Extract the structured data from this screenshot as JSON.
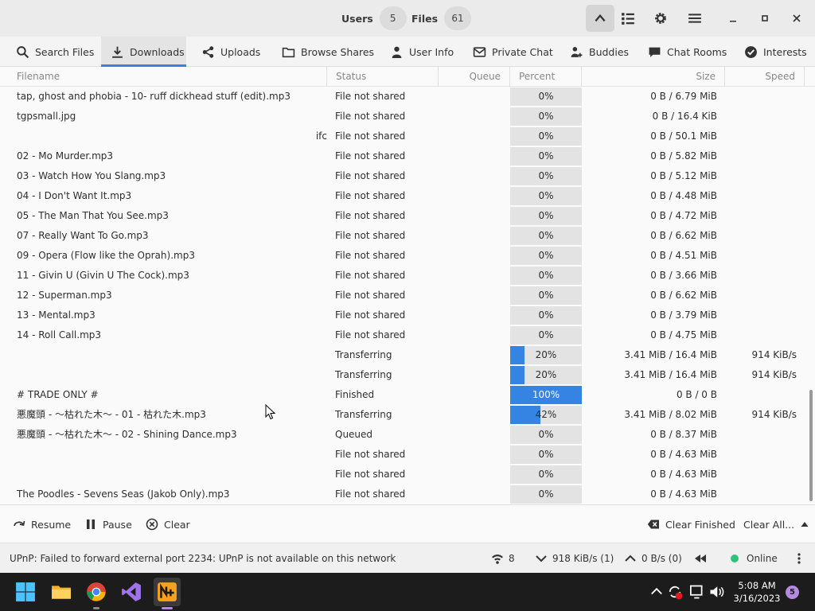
{
  "header": {
    "users_label": "Users",
    "users_count": "5",
    "files_label": "Files",
    "files_count": "61"
  },
  "tabs": [
    {
      "label": "Search Files",
      "icon": "search-icon"
    },
    {
      "label": "Downloads",
      "icon": "download-icon",
      "active": true
    },
    {
      "label": "Uploads",
      "icon": "share-icon"
    },
    {
      "label": "Browse Shares",
      "icon": "folder-icon"
    },
    {
      "label": "User Info",
      "icon": "user-icon"
    },
    {
      "label": "Private Chat",
      "icon": "mail-icon"
    },
    {
      "label": "Buddies",
      "icon": "buddies-icon"
    },
    {
      "label": "Chat Rooms",
      "icon": "chat-bubble-icon"
    },
    {
      "label": "Interests",
      "icon": "check-circle-icon"
    }
  ],
  "columns": [
    "Filename",
    "Status",
    "Queue",
    "Percent",
    "Size",
    "Speed"
  ],
  "rows": [
    {
      "filename": "tap, ghost and phobia - 10- ruff dickhead stuff (edit).mp3",
      "status": "File not shared",
      "queue": "",
      "percent": 0,
      "percent_label": "0%",
      "size": "0 B / 6.79 MiB",
      "speed": ""
    },
    {
      "filename": "tgpsmall.jpg",
      "status": "File not shared",
      "queue": "",
      "percent": 0,
      "percent_label": "0%",
      "size": "0 B / 16.4 KiB",
      "speed": ""
    },
    {
      "filename": "ifc",
      "status": "File not shared",
      "queue": "",
      "percent": 0,
      "percent_label": "0%",
      "size": "0 B / 50.1 MiB",
      "speed": ""
    },
    {
      "filename": "02 - Mo Murder.mp3",
      "status": "File not shared",
      "queue": "",
      "percent": 0,
      "percent_label": "0%",
      "size": "0 B / 5.82 MiB",
      "speed": ""
    },
    {
      "filename": "03 - Watch How You Slang.mp3",
      "status": "File not shared",
      "queue": "",
      "percent": 0,
      "percent_label": "0%",
      "size": "0 B / 5.12 MiB",
      "speed": ""
    },
    {
      "filename": "04 - I Don't Want It.mp3",
      "status": "File not shared",
      "queue": "",
      "percent": 0,
      "percent_label": "0%",
      "size": "0 B / 4.48 MiB",
      "speed": ""
    },
    {
      "filename": "05 - The Man That You See.mp3",
      "status": "File not shared",
      "queue": "",
      "percent": 0,
      "percent_label": "0%",
      "size": "0 B / 4.72 MiB",
      "speed": ""
    },
    {
      "filename": "07 - Really Want To Go.mp3",
      "status": "File not shared",
      "queue": "",
      "percent": 0,
      "percent_label": "0%",
      "size": "0 B / 6.62 MiB",
      "speed": ""
    },
    {
      "filename": "09 - Opera (Flow like the Oprah).mp3",
      "status": "File not shared",
      "queue": "",
      "percent": 0,
      "percent_label": "0%",
      "size": "0 B / 4.51 MiB",
      "speed": ""
    },
    {
      "filename": "11 - Givin U (Givin U The Cock).mp3",
      "status": "File not shared",
      "queue": "",
      "percent": 0,
      "percent_label": "0%",
      "size": "0 B / 3.66 MiB",
      "speed": ""
    },
    {
      "filename": "12 - Superman.mp3",
      "status": "File not shared",
      "queue": "",
      "percent": 0,
      "percent_label": "0%",
      "size": "0 B / 6.62 MiB",
      "speed": ""
    },
    {
      "filename": "13 - Mental.mp3",
      "status": "File not shared",
      "queue": "",
      "percent": 0,
      "percent_label": "0%",
      "size": "0 B / 3.79 MiB",
      "speed": ""
    },
    {
      "filename": "14 - Roll Call.mp3",
      "status": "File not shared",
      "queue": "",
      "percent": 0,
      "percent_label": "0%",
      "size": "0 B / 4.75 MiB",
      "speed": ""
    },
    {
      "filename": "",
      "status": "Transferring",
      "queue": "",
      "percent": 20,
      "percent_label": "20%",
      "size": "3.41 MiB / 16.4 MiB",
      "speed": "914 KiB/s"
    },
    {
      "filename": "",
      "status": "Transferring",
      "queue": "",
      "percent": 20,
      "percent_label": "20%",
      "size": "3.41 MiB / 16.4 MiB",
      "speed": "914 KiB/s"
    },
    {
      "filename": "# TRADE ONLY #",
      "status": "Finished",
      "queue": "",
      "percent": 100,
      "percent_label": "100%",
      "size": "0 B / 0 B",
      "speed": ""
    },
    {
      "filename": "悪魔頭 - ～枯れた木～ - 01 - 枯れた木.mp3",
      "status": "Transferring",
      "queue": "",
      "percent": 42,
      "percent_label": "42%",
      "size": "3.41 MiB / 8.02 MiB",
      "speed": "914 KiB/s"
    },
    {
      "filename": "悪魔頭 - ～枯れた木～ - 02 - Shining Dance.mp3",
      "status": "Queued",
      "queue": "",
      "percent": 0,
      "percent_label": "0%",
      "size": "0 B / 8.37 MiB",
      "speed": ""
    },
    {
      "filename": "",
      "status": "File not shared",
      "queue": "",
      "percent": 0,
      "percent_label": "0%",
      "size": "0 B / 4.63 MiB",
      "speed": ""
    },
    {
      "filename": "",
      "status": "File not shared",
      "queue": "",
      "percent": 0,
      "percent_label": "0%",
      "size": "0 B / 4.63 MiB",
      "speed": ""
    },
    {
      "filename": "The Poodles - Sevens Seas (Jakob Only).mp3",
      "status": "File not shared",
      "queue": "",
      "percent": 0,
      "percent_label": "0%",
      "size": "0 B / 4.63 MiB",
      "speed": ""
    }
  ],
  "actions": {
    "resume": "Resume",
    "pause": "Pause",
    "clear": "Clear",
    "clear_finished": "Clear Finished",
    "clear_all": "Clear All..."
  },
  "statusbar": {
    "message": "UPnP: Failed to forward external port 2234: UPnP is not available on this network",
    "connections": "8",
    "download_speed": "918 KiB/s (1)",
    "upload_speed": "0 B/s (0)",
    "status": "Online"
  },
  "taskbar": {
    "time": "5:08 AM",
    "date": "3/16/2023",
    "notifications": "5",
    "apps": [
      "windows-start-icon",
      "file-explorer-icon",
      "chrome-icon",
      "visual-studio-icon",
      "nicotine-plus-icon"
    ]
  },
  "colors": {
    "accent": "#3584e4",
    "online": "#2ec27e",
    "taskbar": "#1c1c1c"
  }
}
